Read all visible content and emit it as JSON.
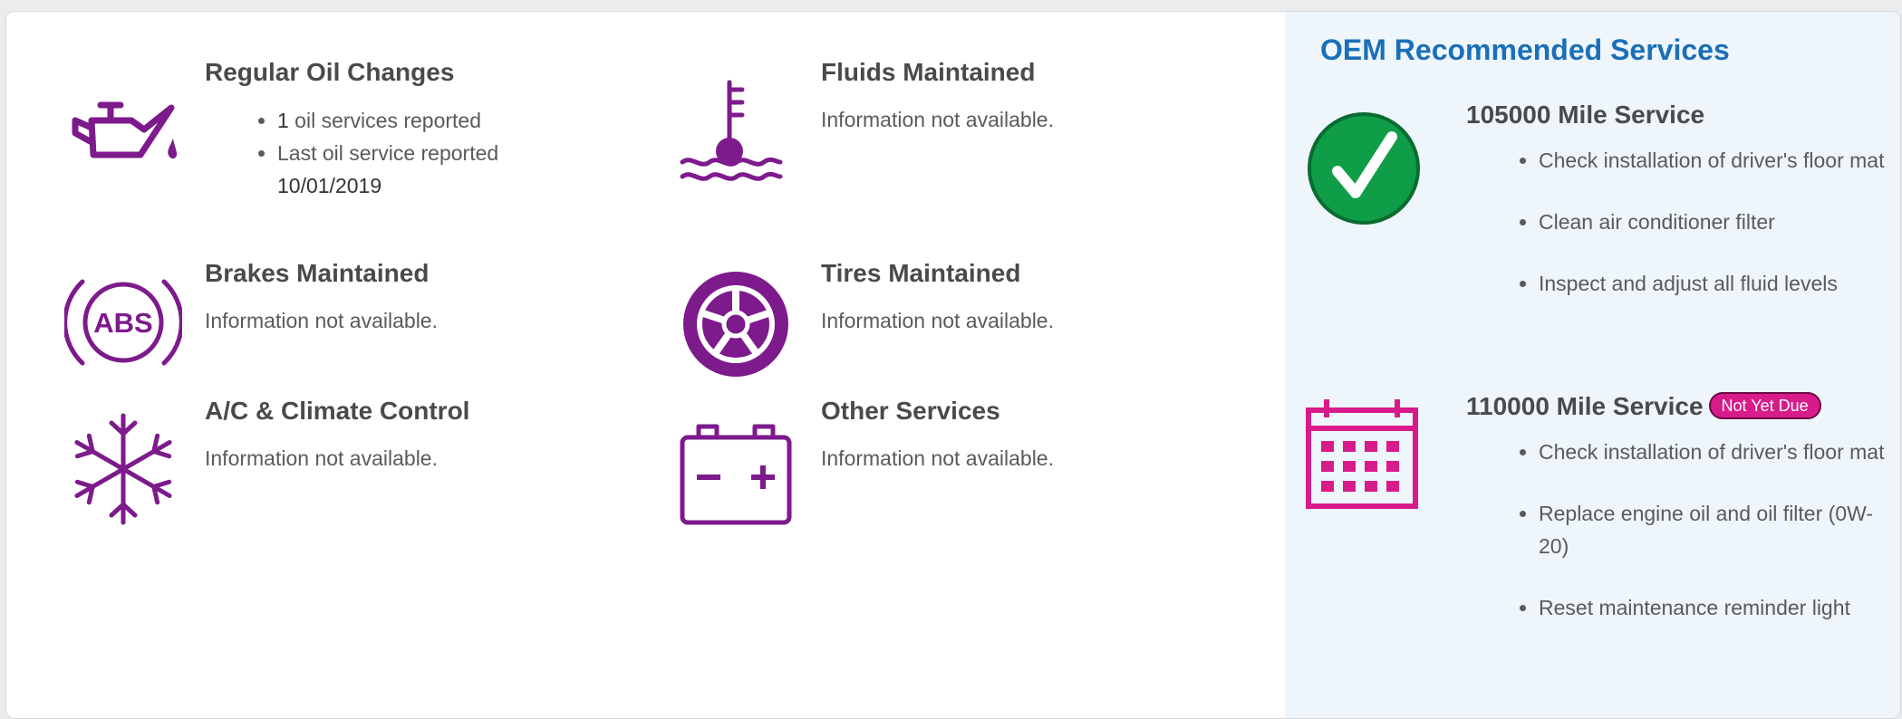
{
  "categories": {
    "oil": {
      "title": "Regular Oil Changes",
      "count": "1",
      "count_suffix": " oil services reported",
      "last_label": "Last oil service reported",
      "last_date": "10/01/2019"
    },
    "fluids": {
      "title": "Fluids Maintained",
      "text": "Information not available."
    },
    "brakes": {
      "title": "Brakes Maintained",
      "text": "Information not available.",
      "abs_label": "ABS"
    },
    "tires": {
      "title": "Tires Maintained",
      "text": "Information not available."
    },
    "ac": {
      "title": "A/C & Climate Control",
      "text": "Information not available."
    },
    "other": {
      "title": "Other Services",
      "text": "Information not available."
    }
  },
  "oem": {
    "title": "OEM Recommended Services",
    "services": [
      {
        "title": "105000 Mile Service",
        "status_icon": "check-icon",
        "items": [
          "Check installation of driver's floor mat",
          "Clean air conditioner filter",
          "Inspect and adjust all fluid levels"
        ]
      },
      {
        "title": "110000 Mile Service",
        "badge": "Not Yet Due",
        "status_icon": "calendar-icon",
        "items": [
          "Check installation of driver's floor mat",
          "Replace engine oil and oil filter (0W-20)",
          "Reset maintenance reminder light"
        ]
      }
    ]
  },
  "colors": {
    "icon_purple": "#7d1a8c",
    "oem_blue": "#1b6fb8",
    "check_green": "#0f9d47",
    "calendar_pink": "#d81b8a",
    "panel_bg": "#eef6fc"
  }
}
